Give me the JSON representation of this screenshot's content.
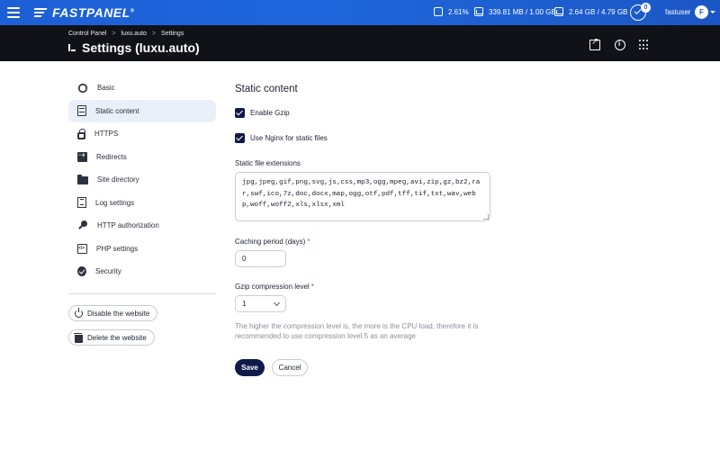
{
  "topbar": {
    "brand": "FASTPANEL",
    "brand_mark": "®",
    "cpu": "2.61%",
    "memory": "339.81 MB / 1.00 GB",
    "disk": "2.64 GB / 4.79 GB",
    "notifications_count": "0",
    "username": "fastuser",
    "avatar_initial": "F"
  },
  "header": {
    "breadcrumb": [
      "Control Panel",
      "luxu.auto",
      "Settings"
    ],
    "breadcrumb_sep": ">",
    "title": "Settings (luxu.auto)"
  },
  "sidebar": {
    "items": [
      {
        "label": "Basic",
        "icon": "gear-icon"
      },
      {
        "label": "Static content",
        "icon": "document-icon",
        "active": true
      },
      {
        "label": "HTTPS",
        "icon": "lock-icon"
      },
      {
        "label": "Redirects",
        "icon": "redirect-icon"
      },
      {
        "label": "Site directory",
        "icon": "folder-icon"
      },
      {
        "label": "Log settings",
        "icon": "log-icon"
      },
      {
        "label": "HTTP authorization",
        "icon": "key-icon"
      },
      {
        "label": "PHP settings",
        "icon": "code-icon"
      },
      {
        "label": "Security",
        "icon": "shield-icon"
      }
    ],
    "disable_label": "Disable the website",
    "delete_label": "Delete the website"
  },
  "main": {
    "section_title": "Static content",
    "gzip_label": "Enable Gzip",
    "gzip_checked": true,
    "nginx_label": "Use Nginx for static files",
    "nginx_checked": true,
    "extensions_label": "Static file extensions",
    "extensions_value": "jpg,jpeg,gif,png,svg,js,css,mp3,ogg,mpeg,avi,zip,gz,bz2,rar,swf,ico,7z,doc,docx,map,ogg,otf,pdf,tff,tif,txt,wav,webp,woff,woff2,xls,xlsx,xml",
    "caching_label": "Caching period (days)",
    "caching_value": "0",
    "gzip_level_label": "Gzip compression level",
    "gzip_level_value": "1",
    "required_mark": "*",
    "hint": "The higher the compression level is, the more is the CPU load, therefore it is recommended to use compression level 5 as an average",
    "save_label": "Save",
    "cancel_label": "Cancel"
  },
  "colors": {
    "topbar": "#1f62d8",
    "header": "#101218",
    "primary_button": "#0f1a4a",
    "active_nav": "#eaf0f9",
    "required": "#e53935"
  }
}
